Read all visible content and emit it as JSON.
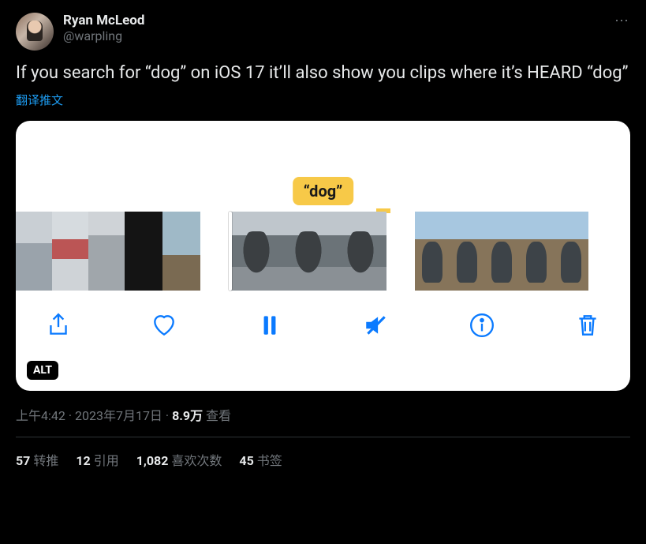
{
  "author": {
    "display_name": "Ryan McLeod",
    "handle": "@warpling"
  },
  "more_icon": "⋯",
  "text": "If you search for “dog” on iOS 17 it’ll also show you clips where it’s HEARD “dog”",
  "translate_label": "翻译推文",
  "media": {
    "badge_text": "“dog”",
    "alt_label": "ALT",
    "toolbar": {
      "share": "share-icon",
      "like": "heart-icon",
      "pause": "pause-icon",
      "mute": "mute-icon",
      "info": "info-icon",
      "trash": "trash-icon"
    }
  },
  "meta": {
    "time": "上午4:42",
    "sep1": " · ",
    "date": "2023年7月17日",
    "sep2": " · ",
    "views_number": "8.9万",
    "views_label": " 查看"
  },
  "stats": {
    "retweets_num": "57",
    "retweets_label": "转推",
    "quotes_num": "12",
    "quotes_label": "引用",
    "likes_num": "1,082",
    "likes_label": "喜欢次数",
    "bookmarks_num": "45",
    "bookmarks_label": "书签"
  }
}
